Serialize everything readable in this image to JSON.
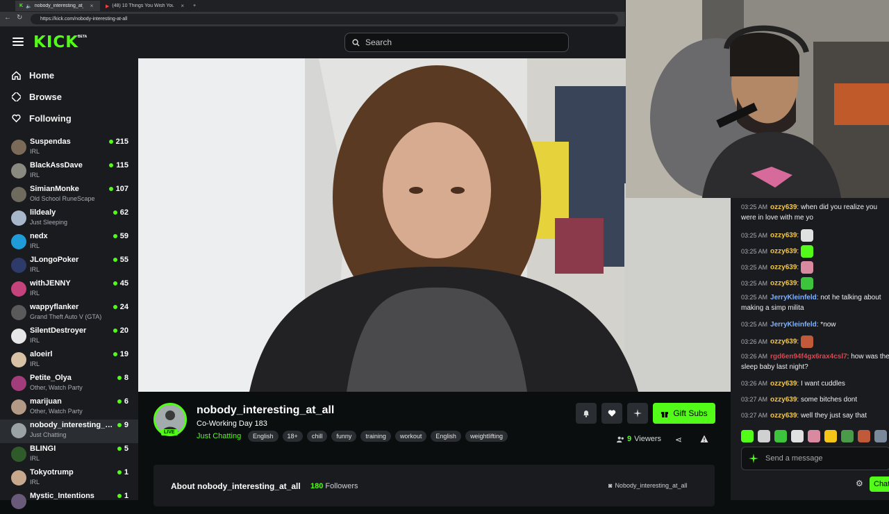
{
  "browser": {
    "tabs": [
      {
        "label": "nobody_interesting_at_all St"
      },
      {
        "label": "(48) 10 Things You Wish You Kne"
      }
    ],
    "url": "https://kick.com/nobody-interesting-at-all"
  },
  "header": {
    "logo": "KICK",
    "badge": "BETA",
    "search_placeholder": "Search"
  },
  "sidebar": {
    "nav": [
      {
        "label": "Home",
        "icon": "home-icon"
      },
      {
        "label": "Browse",
        "icon": "compass-icon"
      },
      {
        "label": "Following",
        "icon": "heart-icon"
      }
    ],
    "channels": [
      {
        "name": "Suspendas",
        "category": "IRL",
        "viewers": "215",
        "color": "#7b6a58"
      },
      {
        "name": "BlackAssDave",
        "category": "IRL",
        "viewers": "115",
        "color": "#8a8a80"
      },
      {
        "name": "SimianMonke",
        "category": "Old School RuneScape",
        "viewers": "107",
        "color": "#6f6a5e"
      },
      {
        "name": "lildealy",
        "category": "Just Sleeping",
        "viewers": "62",
        "color": "#a7b6c9"
      },
      {
        "name": "nedx",
        "category": "IRL",
        "viewers": "59",
        "color": "#1e9bd8"
      },
      {
        "name": "JLongoPoker",
        "category": "IRL",
        "viewers": "55",
        "color": "#2d3a6a"
      },
      {
        "name": "withJENNY",
        "category": "IRL",
        "viewers": "45",
        "color": "#c4437c"
      },
      {
        "name": "wappyflanker",
        "category": "Grand Theft Auto V (GTA)",
        "viewers": "24",
        "color": "#5a5a5a"
      },
      {
        "name": "SilentDestroyer",
        "category": "IRL",
        "viewers": "20",
        "color": "#e6e6e6"
      },
      {
        "name": "aloeirl",
        "category": "IRL",
        "viewers": "19",
        "color": "#d8c2a5"
      },
      {
        "name": "Petite_Olya",
        "category": "Other, Watch Party",
        "viewers": "8",
        "color": "#a33c7b"
      },
      {
        "name": "marijuan",
        "category": "Other, Watch Party",
        "viewers": "6",
        "color": "#b29a86"
      },
      {
        "name": "nobody_interesting_at_all",
        "category": "Just Chatting",
        "viewers": "9",
        "color": "#9aa2a5"
      },
      {
        "name": "BLINGI",
        "category": "IRL",
        "viewers": "5",
        "color": "#2f5b2a"
      },
      {
        "name": "Tokyotrump",
        "category": "IRL",
        "viewers": "1",
        "color": "#c7a88c"
      },
      {
        "name": "Mystic_Intentions",
        "category": "",
        "viewers": "1",
        "color": "#6a5a7a"
      }
    ]
  },
  "stream": {
    "channel": "nobody_interesting_at_all",
    "live": "LIVE",
    "title": "Co-Working Day 183",
    "category": "Just Chatting",
    "tags": [
      "English",
      "18+",
      "chill",
      "funny",
      "training",
      "workout",
      "English",
      "weightlifting"
    ],
    "gift_label": "Gift Subs",
    "viewers_count": "9",
    "viewers_label": "Viewers"
  },
  "about": {
    "title": "About nobody_interesting_at_all",
    "followers_count": "180",
    "followers_label": "Followers",
    "link": "Nobody_interesting_at_all"
  },
  "chat": {
    "messages": [
      {
        "time": "03:25 AM",
        "user": "ozzy639",
        "color": "#f7c948",
        "text": "when did you realize you were in love with me yo"
      },
      {
        "time": "03:25 AM",
        "user": "ozzy639",
        "color": "#f7c948",
        "text": "",
        "emote": "#e0e0e0"
      },
      {
        "time": "03:25 AM",
        "user": "ozzy639",
        "color": "#f7c948",
        "text": "",
        "emote": "#53fc18"
      },
      {
        "time": "03:25 AM",
        "user": "ozzy639",
        "color": "#f7c948",
        "text": "",
        "emote": "#d98aa0"
      },
      {
        "time": "03:25 AM",
        "user": "ozzy639",
        "color": "#f7c948",
        "text": "",
        "emote": "#3cc43c"
      },
      {
        "time": "03:25 AM",
        "user": "JerryKleinfeld",
        "color": "#7fb3ff",
        "text": "not he talking about making a simp milita"
      },
      {
        "time": "03:25 AM",
        "user": "JerryKleinfeld",
        "color": "#7fb3ff",
        "text": "*now"
      },
      {
        "time": "03:26 AM",
        "user": "ozzy639",
        "color": "#f7c948",
        "text": "",
        "emote": "#c05a3a"
      },
      {
        "time": "03:26 AM",
        "user": "rgd6en94f4gx6rax4csl7",
        "color": "#e0454d",
        "text": "how was the sleep baby last night?"
      },
      {
        "time": "03:26 AM",
        "user": "ozzy639",
        "color": "#f7c948",
        "text": "I want cuddles"
      },
      {
        "time": "03:27 AM",
        "user": "ozzy639",
        "color": "#f7c948",
        "text": "some bitches dont"
      },
      {
        "time": "03:27 AM",
        "user": "ozzy639",
        "color": "#f7c948",
        "text": "well they just say that"
      }
    ],
    "emotes": [
      "#53fc18",
      "#d0d0d0",
      "#3cc43c",
      "#e0e0e0",
      "#d98aa0",
      "#f5c518",
      "#4a9a4a",
      "#c05a3a",
      "#7b8a9a"
    ],
    "input_placeholder": "Send a message",
    "send_label": "Chat"
  }
}
